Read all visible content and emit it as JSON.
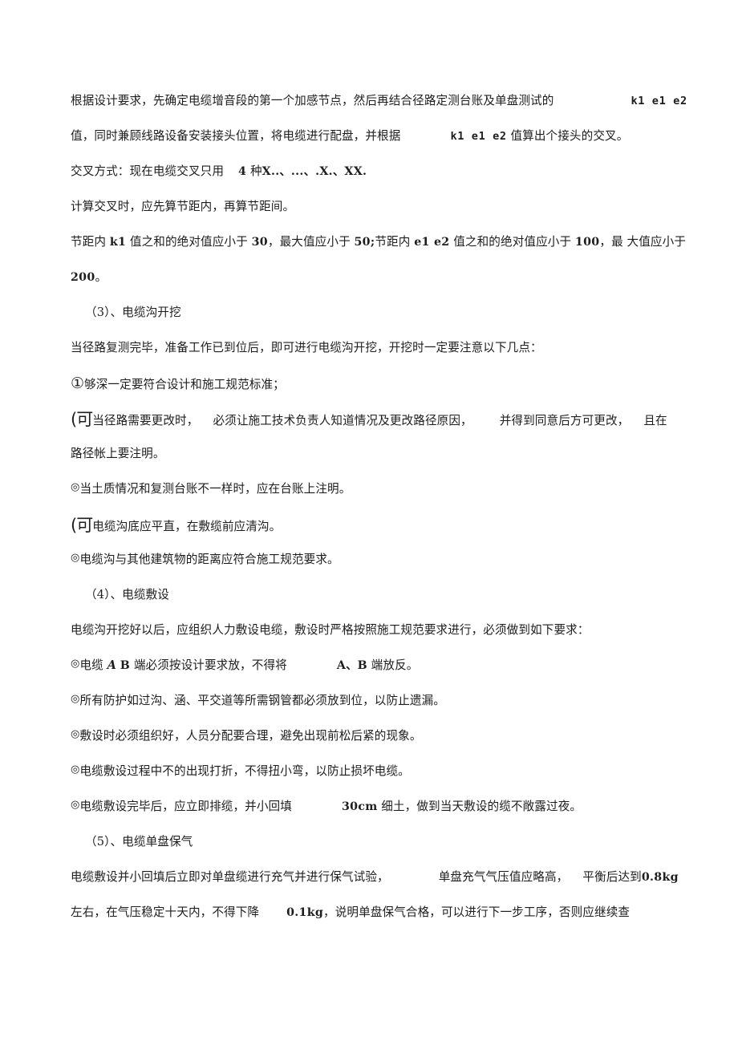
{
  "document": {
    "language": "zh-CN",
    "page_background": "#ffffff",
    "text_color": "#1d1d1d",
    "lines": [
      {
        "id": "para1-line1",
        "segments": [
          {
            "text": "根据设计要求，先确定电缆增音段的第一个加感节点，然后再结合径路定测台账及单盘测试的",
            "style": "normal"
          },
          {
            "text": "",
            "style": "gap-xl"
          },
          {
            "text": "k1 e1 e2",
            "style": "techmono"
          }
        ]
      },
      {
        "id": "para1-line2",
        "segments": [
          {
            "text": "值，同时兼顾线路设备安装接头位置，将电缆进行配盘，并根据",
            "style": "normal"
          },
          {
            "text": "",
            "style": "gap-lg"
          },
          {
            "text": "k1 e1 e2",
            "style": "techmono"
          },
          {
            "text": " 值算出个接头的交叉。",
            "style": "normal"
          }
        ]
      },
      {
        "id": "para2-crossing-method",
        "segments": [
          {
            "text": "交叉方式：现在电缆交叉只用",
            "style": "normal"
          },
          {
            "text": "",
            "style": "gap-sm"
          },
          {
            "text": "4",
            "style": "tech"
          },
          {
            "text": " 种",
            "style": "normal"
          },
          {
            "text": "X..、...、.X.、XX.",
            "style": "tech"
          }
        ]
      },
      {
        "id": "para3-calc-order",
        "segments": [
          {
            "text": "计算交叉时，应先算节距内，再算节距间。",
            "style": "normal"
          }
        ]
      },
      {
        "id": "para4-line1",
        "segments": [
          {
            "text": "节距内 ",
            "style": "normal"
          },
          {
            "text": "k1",
            "style": "tech"
          },
          {
            "text": " 值之和的绝对值应小于 ",
            "style": "normal"
          },
          {
            "text": "30",
            "style": "tech"
          },
          {
            "text": "，最大值应小于 ",
            "style": "normal"
          },
          {
            "text": "50;",
            "style": "tech"
          },
          {
            "text": "节距内 ",
            "style": "normal"
          },
          {
            "text": "e1 e2",
            "style": "tech"
          },
          {
            "text": " 值之和的绝对值应小于 ",
            "style": "normal"
          },
          {
            "text": "100",
            "style": "tech"
          },
          {
            "text": "，最 大值应小于",
            "style": "normal"
          }
        ]
      },
      {
        "id": "para4-line2",
        "segments": [
          {
            "text": "200",
            "style": "tech"
          },
          {
            "text": "。",
            "style": "normal"
          }
        ]
      },
      {
        "id": "heading-3",
        "indent": true,
        "segments": [
          {
            "text": "（3）",
            "style": "normal"
          },
          {
            "text": "、电缆沟开挖",
            "style": "normal"
          }
        ]
      },
      {
        "id": "para5-trench-intro",
        "segments": [
          {
            "text": "当径路复测完毕，准备工作已到位后，即可进行电缆沟开挖，开挖时一定要注意以下几点：",
            "style": "normal"
          }
        ]
      },
      {
        "id": "bullet-1-depth",
        "segments": [
          {
            "text": "①",
            "style": "bullet-circled"
          },
          {
            "text": "够深一定要符合设计和施工规范标准；",
            "style": "normal"
          }
        ]
      },
      {
        "id": "bullet-2-route-change-line1",
        "segments": [
          {
            "text": "(可",
            "style": "bullet-broken"
          },
          {
            "text": "当径路需要更改时，",
            "style": "normal"
          },
          {
            "text": "",
            "style": "gap-sm"
          },
          {
            "text": "必须让施工技术负责人知道情况及更改路径原因，",
            "style": "normal"
          },
          {
            "text": "",
            "style": "gap-md"
          },
          {
            "text": "并得到同意后方可更改，",
            "style": "normal"
          },
          {
            "text": "",
            "style": "gap-sm"
          },
          {
            "text": "且在",
            "style": "normal"
          }
        ]
      },
      {
        "id": "bullet-2-route-change-line2",
        "segments": [
          {
            "text": "路径帐上要注明。",
            "style": "normal"
          }
        ]
      },
      {
        "id": "bullet-3-soil",
        "segments": [
          {
            "text": "◎",
            "style": "bullet-double"
          },
          {
            "text": "当土质情况和复测台账不一样时，应在台账上注明。",
            "style": "normal"
          }
        ]
      },
      {
        "id": "bullet-4-trench-bottom",
        "segments": [
          {
            "text": "(可",
            "style": "bullet-broken"
          },
          {
            "text": "电缆沟底应平直，在敷缆前应清沟。",
            "style": "normal"
          }
        ]
      },
      {
        "id": "bullet-5-distance",
        "segments": [
          {
            "text": "◎",
            "style": "bullet-double"
          },
          {
            "text": "电缆沟与其他建筑物的距离应符合施工规范要求。",
            "style": "normal"
          }
        ]
      },
      {
        "id": "heading-4",
        "indent": true,
        "segments": [
          {
            "text": "（4）",
            "style": "normal"
          },
          {
            "text": "、电缆敷设",
            "style": "normal"
          }
        ]
      },
      {
        "id": "para6-laying-intro",
        "segments": [
          {
            "text": "电缆沟开挖好以后，应组织人力敷设电缆，敷设时严格按照施工规范要求进行，必须做到如下要求：",
            "style": "normal"
          }
        ]
      },
      {
        "id": "bullet-6-ab-ends",
        "segments": [
          {
            "text": "◎",
            "style": "bullet-double"
          },
          {
            "text": "电缆 ",
            "style": "normal"
          },
          {
            "text": "A",
            "style": "ital"
          },
          {
            "text": " ",
            "style": "normal"
          },
          {
            "text": "B",
            "style": "tech"
          },
          {
            "text": " 端必须按设计要求放，不得将",
            "style": "normal"
          },
          {
            "text": "",
            "style": "gap-lg"
          },
          {
            "text": "A、B",
            "style": "tech"
          },
          {
            "text": " 端放反。",
            "style": "normal"
          }
        ]
      },
      {
        "id": "bullet-7-protection",
        "segments": [
          {
            "text": "◎",
            "style": "bullet-double"
          },
          {
            "text": "所有防护如过沟、涵、平交道等所需钢管都必须放到位，以防止遗漏。",
            "style": "normal"
          }
        ]
      },
      {
        "id": "bullet-8-organization",
        "segments": [
          {
            "text": "◎",
            "style": "bullet-double"
          },
          {
            "text": "敷设时必须组织好，人员分配要合理，避免出现前松后紧的现象。",
            "style": "normal"
          }
        ]
      },
      {
        "id": "bullet-9-no-kinks",
        "segments": [
          {
            "text": "◎",
            "style": "bullet-double"
          },
          {
            "text": "电缆敷设过程中不的出现打折，不得扭小弯，以防止损坏电缆。",
            "style": "normal"
          }
        ]
      },
      {
        "id": "bullet-10-backfill",
        "segments": [
          {
            "text": "◎",
            "style": "bullet-double"
          },
          {
            "text": "电缆敷设完毕后，应立即排缆，并小回填",
            "style": "normal"
          },
          {
            "text": "",
            "style": "gap-lg"
          },
          {
            "text": "30cm",
            "style": "tech"
          },
          {
            "text": " 细土，做到当天敷设的缆不敞露过夜。",
            "style": "normal"
          }
        ]
      },
      {
        "id": "heading-5",
        "indent": true,
        "segments": [
          {
            "text": "（5）",
            "style": "normal"
          },
          {
            "text": "、电缆单盘保气",
            "style": "normal"
          }
        ]
      },
      {
        "id": "para7-gas-line1",
        "segments": [
          {
            "text": "电缆敷设并小回填后立即对单盘缆进行充气并进行保气试验，",
            "style": "normal"
          },
          {
            "text": "",
            "style": "gap-lg"
          },
          {
            "text": "单盘充气气压值应略高，",
            "style": "normal"
          },
          {
            "text": "",
            "style": "gap-sm"
          },
          {
            "text": "平衡后达到",
            "style": "normal"
          },
          {
            "text": "0.8kg",
            "style": "tech"
          }
        ]
      },
      {
        "id": "para7-gas-line2",
        "segments": [
          {
            "text": "左右，在气压稳定十天内，不得下降",
            "style": "normal"
          },
          {
            "text": "",
            "style": "gap-md"
          },
          {
            "text": "0.1kg",
            "style": "tech"
          },
          {
            "text": "，说明单盘保气合格，可以进行下一步工序，否则应继续查",
            "style": "normal"
          }
        ]
      }
    ]
  }
}
